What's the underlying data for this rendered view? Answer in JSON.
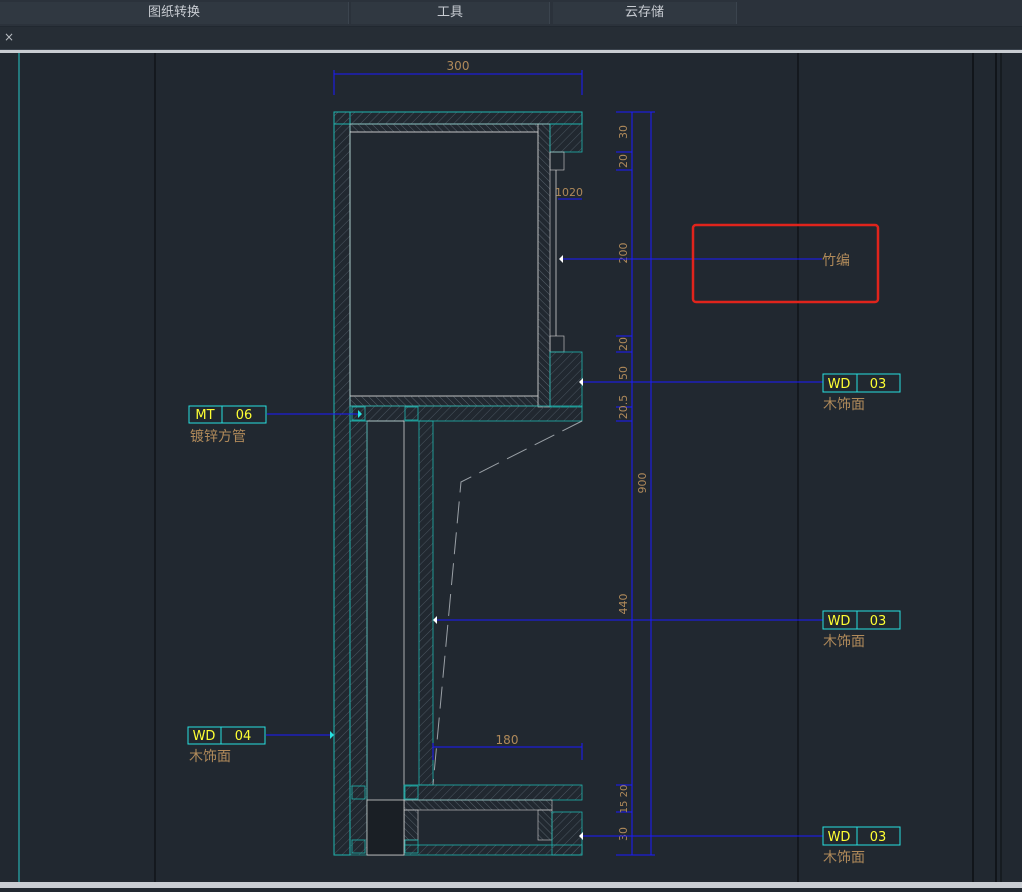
{
  "menu": {
    "drawing_convert": "图纸转换",
    "tools": "工具",
    "cloud_storage": "云存储"
  },
  "tab": {
    "close_glyph": "×"
  },
  "drawing": {
    "dims": {
      "top_width": "300",
      "right_30": "30",
      "right_20a": "20",
      "right_200": "200",
      "right_20b": "20",
      "right_50": "50",
      "right_20_5": "20.5",
      "overall_900": "900",
      "right_440": "440",
      "bottom_180": "180",
      "right_15_20": "15 20",
      "right_30b": "30",
      "inner_1020": "1020"
    },
    "tags": {
      "mt06": {
        "code": "MT",
        "num": "06",
        "desc": "镀锌方管"
      },
      "wd04": {
        "code": "WD",
        "num": "04",
        "desc": "木饰面"
      },
      "wd03_top": {
        "code": "WD",
        "num": "03",
        "desc": "木饰面"
      },
      "wd03_mid": {
        "code": "WD",
        "num": "03",
        "desc": "木饰面"
      },
      "wd03_bot": {
        "code": "WD",
        "num": "03",
        "desc": "木饰面"
      }
    },
    "bamboo_label": "竹编"
  },
  "colors": {
    "background": "#212830",
    "dimension": "#1a1aff",
    "outline": "#1fb6b0",
    "tag_code": "#ffff33",
    "label_text": "#b08a5a",
    "highlight": "#e0241c"
  }
}
